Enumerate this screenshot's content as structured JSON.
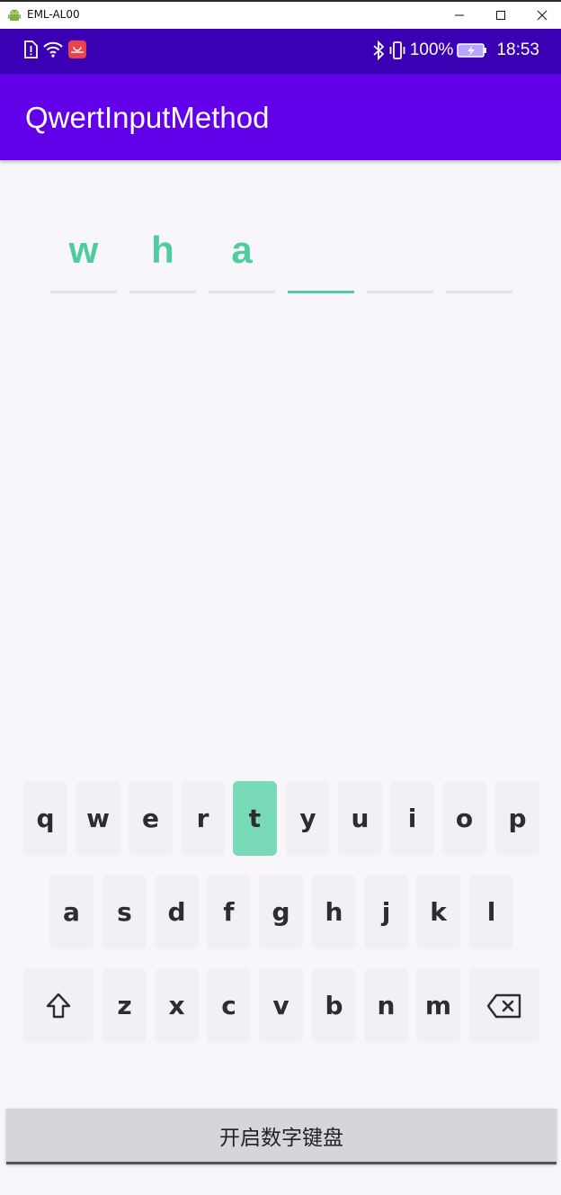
{
  "window": {
    "title": "EML-AL00"
  },
  "status_bar": {
    "battery": "100%",
    "time": "18:53"
  },
  "app_bar": {
    "title": "QwertInputMethod"
  },
  "code_input": {
    "cells": [
      {
        "char": "w",
        "active": false
      },
      {
        "char": "h",
        "active": false
      },
      {
        "char": "a",
        "active": false
      },
      {
        "char": "",
        "active": true
      },
      {
        "char": "",
        "active": false
      },
      {
        "char": "",
        "active": false
      }
    ]
  },
  "keyboard": {
    "row1": [
      "q",
      "w",
      "e",
      "r",
      "t",
      "y",
      "u",
      "i",
      "o",
      "p"
    ],
    "row2": [
      "a",
      "s",
      "d",
      "f",
      "g",
      "h",
      "j",
      "k",
      "l"
    ],
    "row3": [
      "z",
      "x",
      "c",
      "v",
      "b",
      "n",
      "m"
    ],
    "pressed_key": "t",
    "shift_icon": "shift-arrow-icon",
    "backspace_icon": "backspace-icon"
  },
  "numeric_button": {
    "label": "开启数字键盘"
  },
  "colors": {
    "status_bar": "#3a00b3",
    "app_bar": "#6200ea",
    "accent": "#4fcc9e",
    "pressed_key": "#79dab7",
    "key_bg": "#f2f0f5"
  }
}
